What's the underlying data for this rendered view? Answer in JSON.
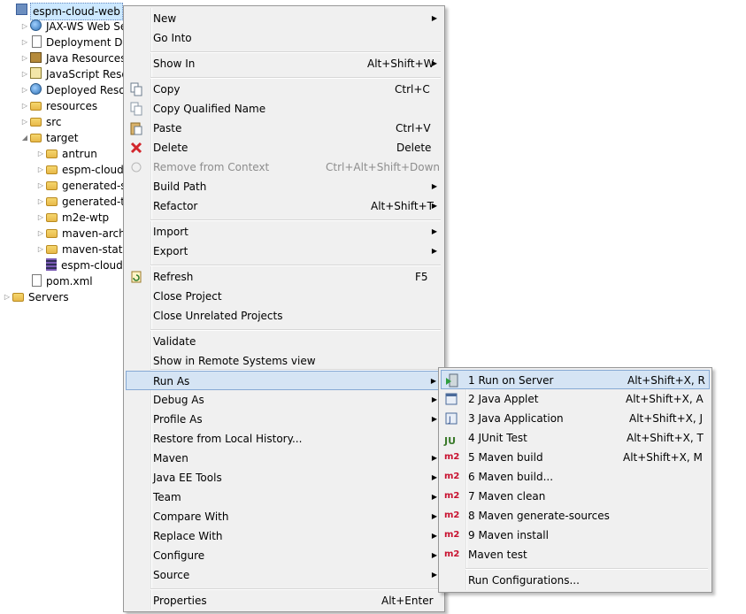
{
  "tree": {
    "project": "espm-cloud-web",
    "items": [
      {
        "label": "JAX-WS Web Se"
      },
      {
        "label": "Deployment De"
      },
      {
        "label": "Java Resources"
      },
      {
        "label": "JavaScript Reso"
      },
      {
        "label": "Deployed Resou"
      },
      {
        "label": "resources"
      },
      {
        "label": "src"
      },
      {
        "label": "target"
      },
      {
        "label": "antrun"
      },
      {
        "label": "espm-cloud"
      },
      {
        "label": "generated-s"
      },
      {
        "label": "generated-t"
      },
      {
        "label": "m2e-wtp"
      },
      {
        "label": "maven-arch"
      },
      {
        "label": "maven-statu"
      },
      {
        "label": "espm-cloud"
      },
      {
        "label": "pom.xml"
      },
      {
        "label": "Servers"
      }
    ]
  },
  "context_menu": {
    "items": [
      {
        "label": "New"
      },
      {
        "label": "Go Into"
      },
      {
        "label": "Show In",
        "accel": "Alt+Shift+W"
      },
      {
        "label": "Copy",
        "accel": "Ctrl+C"
      },
      {
        "label": "Copy Qualified Name"
      },
      {
        "label": "Paste",
        "accel": "Ctrl+V"
      },
      {
        "label": "Delete",
        "accel": "Delete"
      },
      {
        "label": "Remove from Context",
        "accel": "Ctrl+Alt+Shift+Down"
      },
      {
        "label": "Build Path"
      },
      {
        "label": "Refactor",
        "accel": "Alt+Shift+T"
      },
      {
        "label": "Import"
      },
      {
        "label": "Export"
      },
      {
        "label": "Refresh",
        "accel": "F5"
      },
      {
        "label": "Close Project"
      },
      {
        "label": "Close Unrelated Projects"
      },
      {
        "label": "Validate"
      },
      {
        "label": "Show in Remote Systems view"
      },
      {
        "label": "Run As"
      },
      {
        "label": "Debug As"
      },
      {
        "label": "Profile As"
      },
      {
        "label": "Restore from Local History..."
      },
      {
        "label": "Maven"
      },
      {
        "label": "Java EE Tools"
      },
      {
        "label": "Team"
      },
      {
        "label": "Compare With"
      },
      {
        "label": "Replace With"
      },
      {
        "label": "Configure"
      },
      {
        "label": "Source"
      },
      {
        "label": "Properties",
        "accel": "Alt+Enter"
      }
    ]
  },
  "run_as_menu": {
    "items": [
      {
        "label": "1 Run on Server",
        "accel": "Alt+Shift+X, R"
      },
      {
        "label": "2 Java Applet",
        "accel": "Alt+Shift+X, A"
      },
      {
        "label": "3 Java Application",
        "accel": "Alt+Shift+X, J"
      },
      {
        "label": "4 JUnit Test",
        "accel": "Alt+Shift+X, T"
      },
      {
        "label": "5 Maven build",
        "accel": "Alt+Shift+X, M"
      },
      {
        "label": "6 Maven build..."
      },
      {
        "label": "7 Maven clean"
      },
      {
        "label": "8 Maven generate-sources"
      },
      {
        "label": "9 Maven install"
      },
      {
        "label": "Maven test"
      },
      {
        "label": "Run Configurations..."
      }
    ],
    "m2_icon_text": "m2",
    "junit_icon_text": "JU"
  },
  "colors": {
    "menu_bg": "#f0f0f0",
    "hover_bg": "#d5e4f4",
    "hover_border": "#86a9d4",
    "disabled_text": "#8d8d8d",
    "m2_red": "#c8102e"
  }
}
